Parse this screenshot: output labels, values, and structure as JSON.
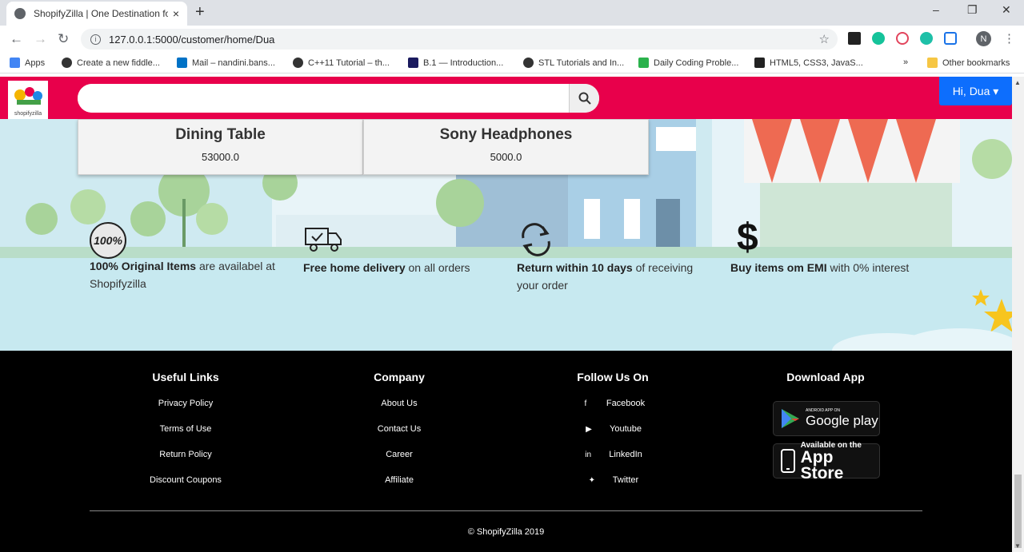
{
  "browser": {
    "tab_title": "ShopifyZilla | One Destination fo",
    "tab_close": "×",
    "new_tab": "+",
    "url": "127.0.0.1:5000/customer/home/Dua",
    "win_min": "–",
    "win_max": "❐",
    "win_close": "✕",
    "profile_initial": "N",
    "bookmarks": [
      {
        "label": "Apps",
        "color": "#4285f4"
      },
      {
        "label": "Create a new fiddle...",
        "color": "#333333"
      },
      {
        "label": "Mail – nandini.bans...",
        "color": "#0072c6"
      },
      {
        "label": "C++11 Tutorial – th...",
        "color": "#333333"
      },
      {
        "label": "B.1 — Introduction...",
        "color": "#1a1a5e"
      },
      {
        "label": "STL Tutorials and In...",
        "color": "#333333"
      },
      {
        "label": "Daily Coding Proble...",
        "color": "#2bb24c"
      },
      {
        "label": "HTML5, CSS3, JavaS...",
        "color": "#222222"
      }
    ],
    "more": "»",
    "other_bookmarks": "Other bookmarks"
  },
  "navbar": {
    "logo_text": "shopifyzilla",
    "search_placeholder": "",
    "user_menu": "Hi, Dua ▾",
    "brand_color": "#e8004b"
  },
  "products": [
    {
      "name": "Dining Table",
      "price": "53000.0"
    },
    {
      "name": "Sony Headphones",
      "price": "5000.0"
    }
  ],
  "features": [
    {
      "bold": "100% Original Items",
      "rest": " are availabel at Shopifyzilla",
      "icon": "guarantee-seal-icon",
      "seal": "100%"
    },
    {
      "bold": "Free home delivery",
      "rest": " on all orders",
      "icon": "delivery-truck-icon"
    },
    {
      "bold": "Return within 10 days",
      "rest": " of receiving your order",
      "icon": "return-arrows-icon"
    },
    {
      "bold": "Buy items om EMI",
      "rest": " with 0% interest",
      "icon": "dollar-icon",
      "glyph": "$"
    }
  ],
  "footer": {
    "useful_links": {
      "heading": "Useful Links",
      "items": [
        "Privacy Policy",
        "Terms of Use",
        "Return Policy",
        "Discount Coupons"
      ]
    },
    "company": {
      "heading": "Company",
      "items": [
        "About Us",
        "Contact Us",
        "Career",
        "Affiliate"
      ]
    },
    "follow": {
      "heading": "Follow Us On",
      "items": [
        {
          "label": "Facebook",
          "icon": "facebook-icon",
          "glyph": "f"
        },
        {
          "label": "Youtube",
          "icon": "youtube-icon",
          "glyph": "▶"
        },
        {
          "label": "LinkedIn",
          "icon": "linkedin-icon",
          "glyph": "in"
        },
        {
          "label": "Twitter",
          "icon": "twitter-icon",
          "glyph": "✦"
        }
      ]
    },
    "download": {
      "heading": "Download App",
      "google_small": "ANDROID APP ON",
      "google_big": "Google play",
      "apple_small": "Available on the",
      "apple_big": "App Store"
    },
    "copyright": "© ShopifyZilla 2019"
  }
}
